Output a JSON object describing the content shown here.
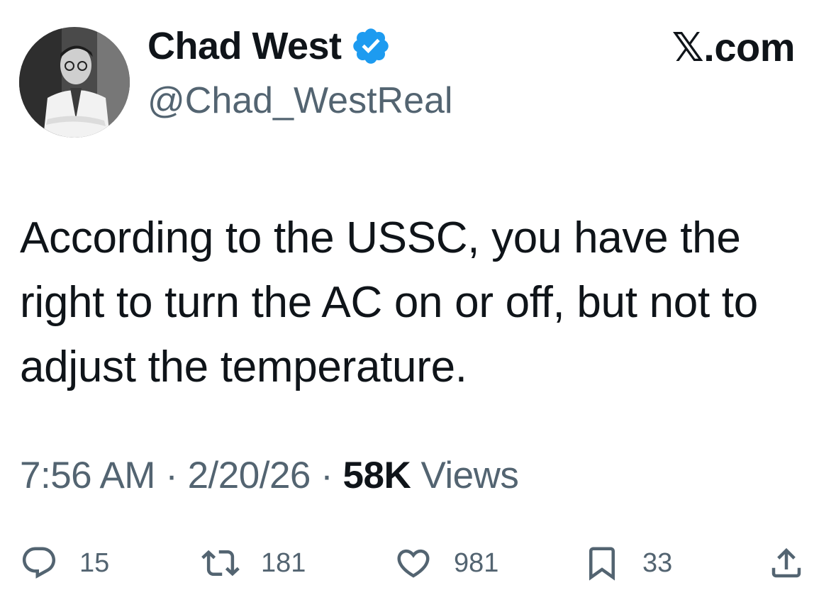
{
  "author": {
    "display_name": "Chad West",
    "handle": "@Chad_WestReal",
    "verified": true,
    "verified_color": "#1d9bf0"
  },
  "source": "𝕏.com",
  "tweet": {
    "text": "According to the USSC, you have the right to turn the AC on or off, but not to adjust the temperature."
  },
  "meta": {
    "time": "7:56 AM",
    "separator": " · ",
    "date": "2/20/26",
    "views_count": "58K",
    "views_label": " Views"
  },
  "actions": {
    "replies": "15",
    "retweets": "181",
    "likes": "981",
    "bookmarks": "33"
  },
  "icons": {
    "reply": "reply-icon",
    "retweet": "retweet-icon",
    "like": "heart-icon",
    "bookmark": "bookmark-icon",
    "share": "share-icon"
  },
  "colors": {
    "text": "#0f1419",
    "secondary": "#536471"
  }
}
